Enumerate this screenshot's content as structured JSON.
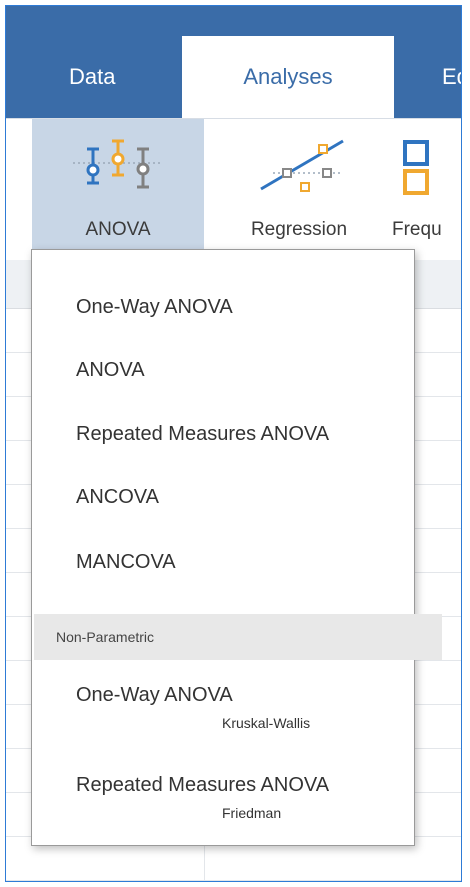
{
  "tabs": [
    {
      "label": "Data"
    },
    {
      "label": "Analyses"
    },
    {
      "label": "Ed"
    }
  ],
  "ribbon": {
    "buttons": [
      {
        "label": "ANOVA",
        "icon": "anova-icon"
      },
      {
        "label": "Regression",
        "icon": "regression-icon"
      },
      {
        "label": "Frequ",
        "icon": "frequencies-icon"
      }
    ]
  },
  "menu": {
    "items": [
      {
        "label": "One-Way ANOVA"
      },
      {
        "label": "ANOVA"
      },
      {
        "label": "Repeated Measures ANOVA"
      },
      {
        "label": "ANCOVA"
      },
      {
        "label": "MANCOVA"
      }
    ],
    "section_label": "Non-Parametric",
    "nonparametric": [
      {
        "label": "One-Way ANOVA",
        "sublabel": "Kruskal-Wallis"
      },
      {
        "label": "Repeated Measures ANOVA",
        "sublabel": "Friedman"
      }
    ]
  },
  "colors": {
    "accent": "#3a6ca8",
    "anova_icon_blue": "#2f74c0",
    "anova_icon_orange": "#f0a830",
    "anova_icon_gray": "#808080"
  }
}
